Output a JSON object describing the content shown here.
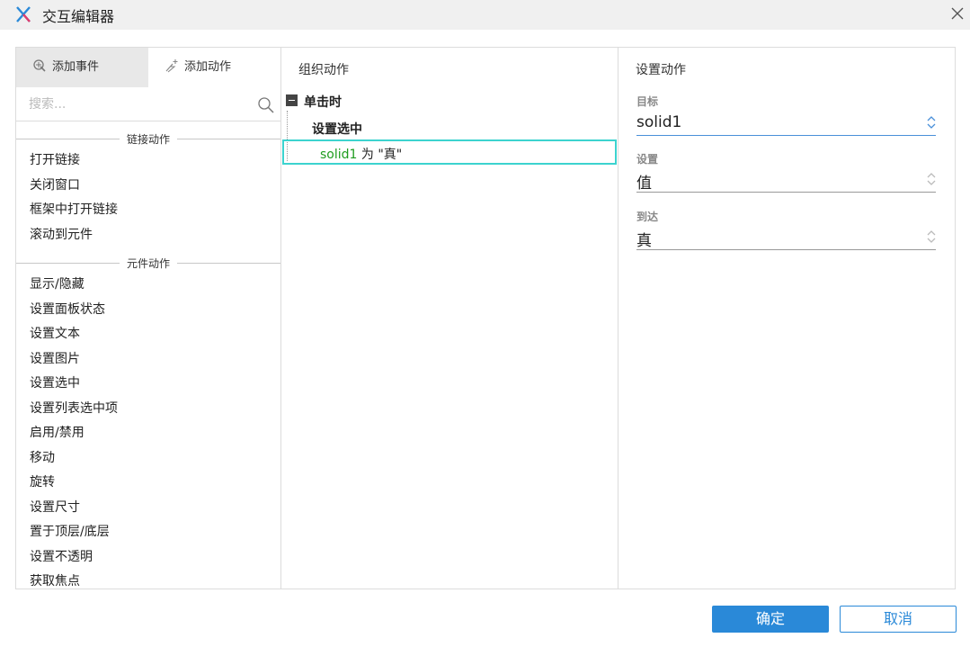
{
  "window": {
    "title": "交互编辑器",
    "logo_icon": "axure-x-logo",
    "close_icon": "close-icon"
  },
  "left": {
    "tabs": [
      {
        "label": "添加事件",
        "icon": "add-event-icon"
      },
      {
        "label": "添加动作",
        "icon": "add-action-icon"
      }
    ],
    "search_placeholder": "搜索...",
    "sections": [
      {
        "title": "链接动作",
        "items": [
          "打开链接",
          "关闭窗口",
          "框架中打开链接",
          "滚动到元件"
        ]
      },
      {
        "title": "元件动作",
        "items": [
          "显示/隐藏",
          "设置面板状态",
          "设置文本",
          "设置图片",
          "设置选中",
          "设置列表选中项",
          "启用/禁用",
          "移动",
          "旋转",
          "设置尺寸",
          "置于顶层/底层",
          "设置不透明",
          "获取焦点"
        ]
      }
    ]
  },
  "middle": {
    "header": "组织动作",
    "event": "单击时",
    "action": "设置选中",
    "detail": {
      "target": "solid1",
      "middle": " 为 ",
      "value": "\"真\""
    }
  },
  "right": {
    "header": "设置动作",
    "fields": [
      {
        "label": "目标",
        "value": "solid1"
      },
      {
        "label": "设置",
        "value": "值"
      },
      {
        "label": "到达",
        "value": "真"
      }
    ]
  },
  "footer": {
    "ok_label": "确定",
    "cancel_label": "取消"
  },
  "colors": {
    "accent": "#2a89d8",
    "highlight": "#3cd3cf",
    "target_text": "#1f9c1f"
  }
}
